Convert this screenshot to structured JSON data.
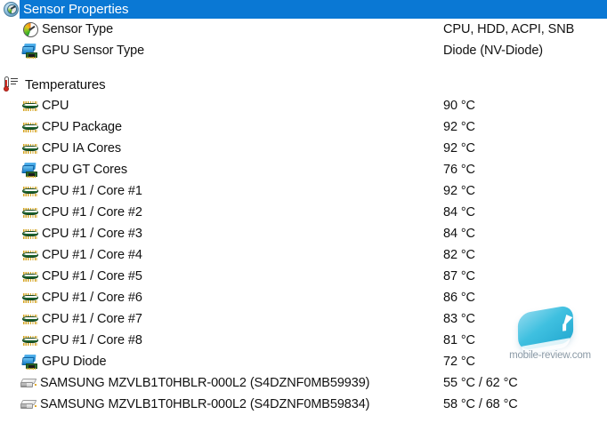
{
  "sections": [
    {
      "id": "sensor-properties",
      "title": "Sensor Properties",
      "icon": "gauge-sphere-icon",
      "selected": true,
      "rows": [
        {
          "icon": "gauge-icon",
          "label": "Sensor Type",
          "value": "CPU, HDD, ACPI, SNB"
        },
        {
          "icon": "gpu-icon",
          "label": "GPU Sensor Type",
          "value": "Diode  (NV-Diode)"
        }
      ]
    },
    {
      "id": "temperatures",
      "title": "Temperatures",
      "icon": "thermometer-icon",
      "selected": false,
      "rows": [
        {
          "icon": "chip-icon",
          "label": "CPU",
          "value": "90 °C"
        },
        {
          "icon": "chip-icon",
          "label": "CPU Package",
          "value": "92 °C"
        },
        {
          "icon": "chip-icon",
          "label": "CPU IA Cores",
          "value": "92 °C"
        },
        {
          "icon": "gpu-icon",
          "label": "CPU GT Cores",
          "value": "76 °C"
        },
        {
          "icon": "chip-icon",
          "label": "CPU #1 / Core #1",
          "value": "92 °C"
        },
        {
          "icon": "chip-icon",
          "label": "CPU #1 / Core #2",
          "value": "84 °C"
        },
        {
          "icon": "chip-icon",
          "label": "CPU #1 / Core #3",
          "value": "84 °C"
        },
        {
          "icon": "chip-icon",
          "label": "CPU #1 / Core #4",
          "value": "82 °C"
        },
        {
          "icon": "chip-icon",
          "label": "CPU #1 / Core #5",
          "value": "87 °C"
        },
        {
          "icon": "chip-icon",
          "label": "CPU #1 / Core #6",
          "value": "86 °C"
        },
        {
          "icon": "chip-icon",
          "label": "CPU #1 / Core #7",
          "value": "83 °C"
        },
        {
          "icon": "chip-icon",
          "label": "CPU #1 / Core #8",
          "value": "81 °C"
        },
        {
          "icon": "gpu-icon",
          "label": "GPU Diode",
          "value": "72 °C"
        },
        {
          "icon": "drive-icon",
          "label": "SAMSUNG MZVLB1T0HBLR-000L2 (S4DZNF0MB59939)",
          "value": "55 °C / 62 °C"
        },
        {
          "icon": "drive-icon",
          "label": "SAMSUNG MZVLB1T0HBLR-000L2 (S4DZNF0MB59834)",
          "value": "58 °C / 68 °C"
        }
      ]
    }
  ],
  "watermark": {
    "text": "mobile-review.com",
    "icon": "cursor-badge-icon"
  },
  "colors": {
    "selection": "#0a78d4",
    "selection_text": "#ffffff",
    "text": "#111111",
    "background": "#ffffff",
    "watermark_text": "#8b9aa6",
    "watermark_badge": "#3fc0e0"
  }
}
